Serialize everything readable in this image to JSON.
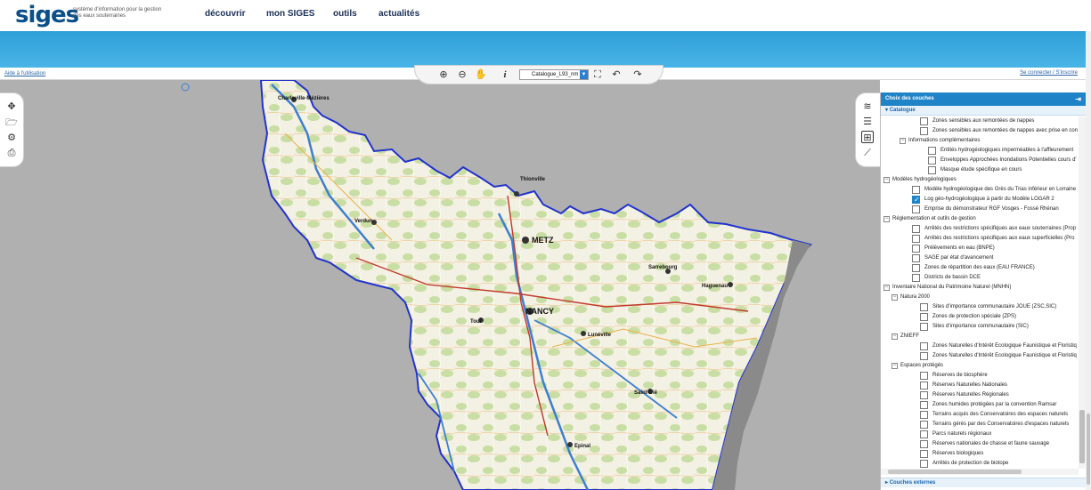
{
  "header": {
    "logo": "siges",
    "tagline": "système d'information pour la gestion des eaux souterraines",
    "nav": [
      "découvrir",
      "mon SIGES",
      "outils",
      "actualités"
    ]
  },
  "subbar": {
    "help_link": "Aide à l'utilisation",
    "login_link": "Se connecter / S'inscrire"
  },
  "toolbar": {
    "tools": [
      "zoom-in-icon",
      "zoom-out-icon",
      "pan-icon",
      "info-icon",
      "catalog-select",
      "full-extent-icon",
      "undo-icon",
      "redo-icon"
    ],
    "catalog_value": "Catalogue_L93_nm",
    "info_glyph": "i"
  },
  "left_tools": [
    "move-icon",
    "folder-icon",
    "settings-icon",
    "print-icon"
  ],
  "right_tools": [
    "layers-icon",
    "legend-icon",
    "add-layer-icon",
    "measure-icon"
  ],
  "panel": {
    "title": "Choix des couches",
    "catalog_label": "Catalogue",
    "external_label": "Couches externes",
    "rows": [
      {
        "level": 3,
        "type": "check",
        "checked": false,
        "label": "Zones sensibles aux remontées de nappes"
      },
      {
        "level": 3,
        "type": "check",
        "checked": false,
        "label": "Zones sensibles aux remontées de nappes avec prise en con"
      },
      {
        "level": 2,
        "type": "group",
        "label": "Informations complémentaires"
      },
      {
        "level": 4,
        "type": "check",
        "checked": false,
        "label": "Entités hydrogéologiques imperméables à l'affleurement"
      },
      {
        "level": 4,
        "type": "check",
        "checked": false,
        "label": "Enveloppes Approchées Inondations Potentielles cours d'"
      },
      {
        "level": 4,
        "type": "check",
        "checked": false,
        "label": "Masque étude spécifique en cours"
      },
      {
        "level": 0,
        "type": "group",
        "label": "Modèles hydrogéologiques"
      },
      {
        "level": 2,
        "type": "check",
        "checked": false,
        "label": "Modèle hydrogéologique des Grès du Trias inférieur en Lorraine"
      },
      {
        "level": 2,
        "type": "check",
        "checked": true,
        "label": "Log géo-hydrogéologique à partir du Modèle LOGAR 2"
      },
      {
        "level": 2,
        "type": "check",
        "checked": false,
        "label": "Emprise du démonstrateur RGF Vosges - Fossé Rhénan"
      },
      {
        "level": 0,
        "type": "group",
        "label": "Réglementation et outils de gestion"
      },
      {
        "level": 2,
        "type": "check",
        "checked": false,
        "label": "Arrêtés des restrictions spécifiques aux eaux souterraines (Prop"
      },
      {
        "level": 2,
        "type": "check",
        "checked": false,
        "label": "Arrêtés des restrictions spécifiques aux eaux superficielles (Pro"
      },
      {
        "level": 2,
        "type": "check",
        "checked": false,
        "label": "Prélèvements en eau (BNPE)"
      },
      {
        "level": 2,
        "type": "check",
        "checked": false,
        "label": "SAGE par état d'avancement"
      },
      {
        "level": 2,
        "type": "check",
        "checked": false,
        "label": "Zones de répartition des eaux (EAU FRANCE)"
      },
      {
        "level": 2,
        "type": "check",
        "checked": false,
        "label": "Districts de bassin DCE"
      },
      {
        "level": 0,
        "type": "group",
        "label": "Inventaire National du Patrimoine Naturel (MNHN)"
      },
      {
        "level": 1,
        "type": "group",
        "label": "Natura 2000"
      },
      {
        "level": 3,
        "type": "check",
        "checked": false,
        "label": "Sites d'importance communautaire JOUE (ZSC,SIC)"
      },
      {
        "level": 3,
        "type": "check",
        "checked": false,
        "label": "Zones de protection spéciale (ZPS)"
      },
      {
        "level": 3,
        "type": "check",
        "checked": false,
        "label": "Sites d'importance communautaire (SIC)"
      },
      {
        "level": 1,
        "type": "group",
        "label": "ZNIEFF"
      },
      {
        "level": 3,
        "type": "check",
        "checked": false,
        "label": "Zones Naturelles d'Intérêt Ecologique Faunistique et Floristiq"
      },
      {
        "level": 3,
        "type": "check",
        "checked": false,
        "label": "Zones Naturelles d'Intérêt Ecologique Faunistique et Floristiq"
      },
      {
        "level": 1,
        "type": "group",
        "label": "Espaces protégés"
      },
      {
        "level": 3,
        "type": "check",
        "checked": false,
        "label": "Réserves de biosphère"
      },
      {
        "level": 3,
        "type": "check",
        "checked": false,
        "label": "Réserves Naturelles Nationales"
      },
      {
        "level": 3,
        "type": "check",
        "checked": false,
        "label": "Réserves Naturelles Régionales"
      },
      {
        "level": 3,
        "type": "check",
        "checked": false,
        "label": "Zones humides protégées par la convention Ramsar"
      },
      {
        "level": 3,
        "type": "check",
        "checked": false,
        "label": "Terrains acquis des Conservatoires des espaces naturels"
      },
      {
        "level": 3,
        "type": "check",
        "checked": false,
        "label": "Terrains gérés par des Conservatoires d'espaces naturels"
      },
      {
        "level": 3,
        "type": "check",
        "checked": false,
        "label": "Parcs naturels régionaux"
      },
      {
        "level": 3,
        "type": "check",
        "checked": false,
        "label": "Réserves nationales de chasse et faune sauvage"
      },
      {
        "level": 3,
        "type": "check",
        "checked": false,
        "label": "Réserves biologiques"
      },
      {
        "level": 3,
        "type": "check",
        "checked": false,
        "label": "Arrêtés de protection de biotope"
      }
    ]
  },
  "map": {
    "cities": [
      "Charleville-Mézières",
      "Thionville",
      "METZ",
      "NANCY",
      "Haguenau",
      "Verdun",
      "Lunéville",
      "Epinal",
      "Saint-Dié",
      "Toul",
      "Sarrebourg"
    ],
    "colors": {
      "background": "#b0b0b0",
      "land": "#f3f1e3",
      "forest": "#c9dea4",
      "border": "#2233cc",
      "river": "#3e7fcf",
      "rhine": "#8a8a8a"
    }
  }
}
